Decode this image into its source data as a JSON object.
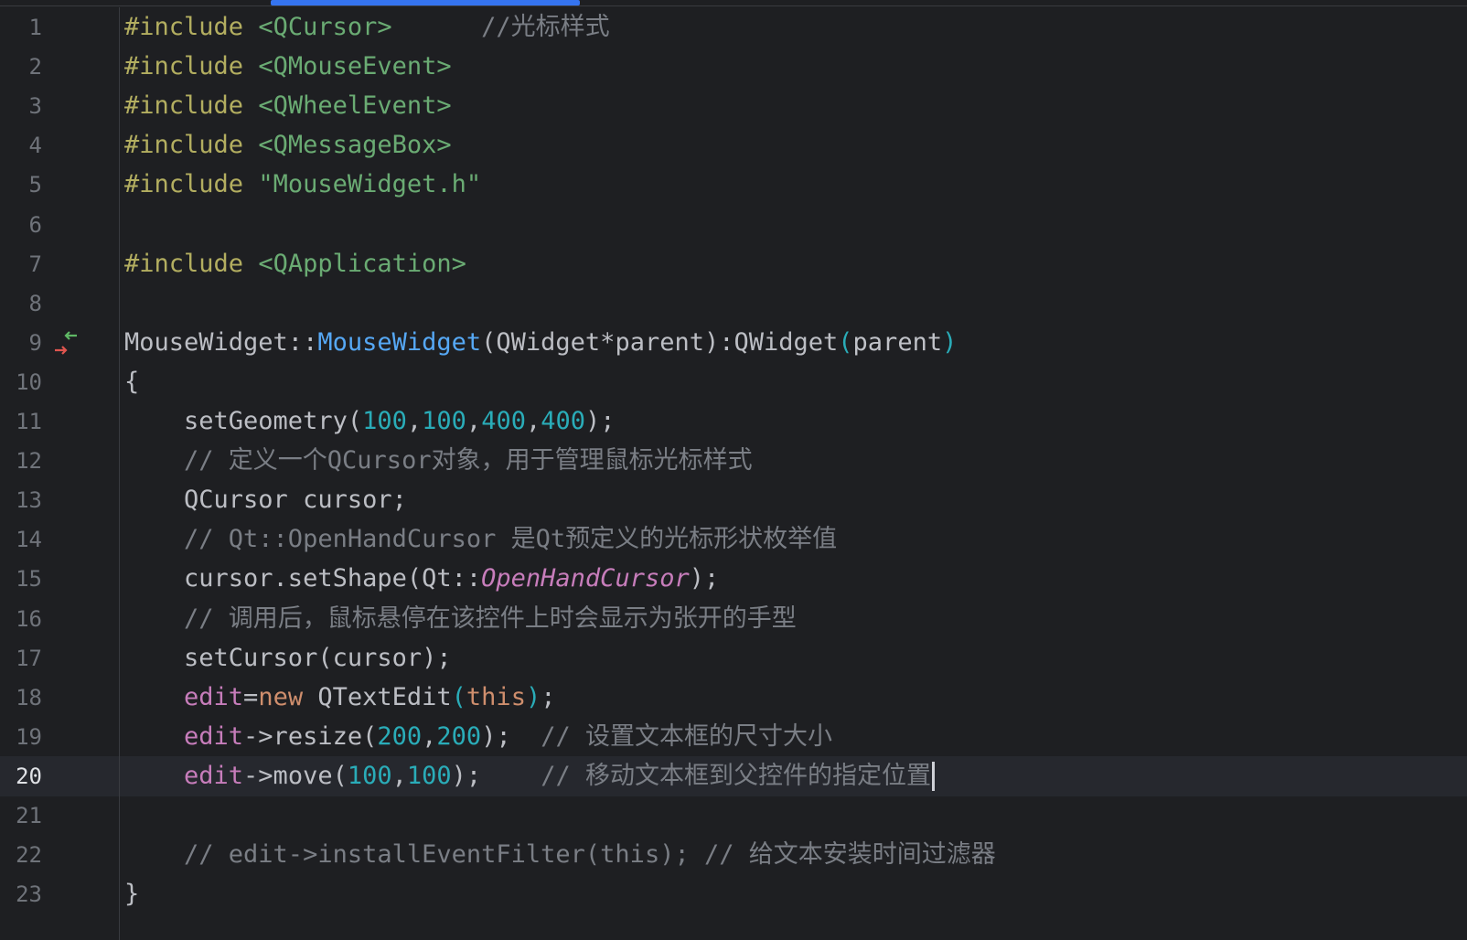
{
  "lines": [
    {
      "n": "1",
      "parts": [
        {
          "c": "kw-pp",
          "t": "#include "
        },
        {
          "c": "inc",
          "t": "<QCursor>"
        },
        {
          "c": "cmt",
          "t": "      //光标样式"
        }
      ]
    },
    {
      "n": "2",
      "parts": [
        {
          "c": "kw-pp",
          "t": "#include "
        },
        {
          "c": "inc",
          "t": "<QMouseEvent>"
        }
      ]
    },
    {
      "n": "3",
      "parts": [
        {
          "c": "kw-pp",
          "t": "#include "
        },
        {
          "c": "inc",
          "t": "<QWheelEvent>"
        }
      ]
    },
    {
      "n": "4",
      "parts": [
        {
          "c": "kw-pp",
          "t": "#include "
        },
        {
          "c": "inc",
          "t": "<QMessageBox>"
        }
      ]
    },
    {
      "n": "5",
      "parts": [
        {
          "c": "kw-pp",
          "t": "#include "
        },
        {
          "c": "inc",
          "t": "\"MouseWidget.h\""
        }
      ]
    },
    {
      "n": "6",
      "parts": []
    },
    {
      "n": "7",
      "parts": [
        {
          "c": "kw-pp",
          "t": "#include "
        },
        {
          "c": "inc",
          "t": "<QApplication>"
        }
      ]
    },
    {
      "n": "8",
      "parts": []
    },
    {
      "n": "9",
      "parts": [
        {
          "c": "cls",
          "t": "MouseWidget::"
        },
        {
          "c": "fnc",
          "t": "MouseWidget"
        },
        {
          "c": "cls",
          "t": "(QWidget*parent):QWidget"
        },
        {
          "c": "paren-hl",
          "t": "("
        },
        {
          "c": "par",
          "t": "parent"
        },
        {
          "c": "paren-hl",
          "t": ")"
        }
      ]
    },
    {
      "n": "10",
      "parts": [
        {
          "c": "cls",
          "t": "{"
        }
      ]
    },
    {
      "n": "11",
      "parts": [
        {
          "c": "cls",
          "t": "    setGeometry("
        },
        {
          "c": "num",
          "t": "100"
        },
        {
          "c": "cls",
          "t": ","
        },
        {
          "c": "num",
          "t": "100"
        },
        {
          "c": "cls",
          "t": ","
        },
        {
          "c": "num",
          "t": "400"
        },
        {
          "c": "cls",
          "t": ","
        },
        {
          "c": "num",
          "t": "400"
        },
        {
          "c": "cls",
          "t": ");"
        }
      ]
    },
    {
      "n": "12",
      "parts": [
        {
          "c": "cmt",
          "t": "    // 定义一个QCursor对象，用于管理鼠标光标样式"
        }
      ]
    },
    {
      "n": "13",
      "parts": [
        {
          "c": "cls",
          "t": "    QCursor cursor;"
        }
      ]
    },
    {
      "n": "14",
      "parts": [
        {
          "c": "cmt",
          "t": "    // Qt::OpenHandCursor 是Qt预定义的光标形状枚举值"
        }
      ]
    },
    {
      "n": "15",
      "parts": [
        {
          "c": "cls",
          "t": "    cursor.setShape(Qt::"
        },
        {
          "c": "enum",
          "t": "OpenHandCursor"
        },
        {
          "c": "cls",
          "t": ");"
        }
      ]
    },
    {
      "n": "16",
      "parts": [
        {
          "c": "cmt",
          "t": "    // 调用后，鼠标悬停在该控件上时会显示为张开的手型"
        }
      ]
    },
    {
      "n": "17",
      "parts": [
        {
          "c": "cls",
          "t": "    setCursor(cursor);"
        }
      ]
    },
    {
      "n": "18",
      "parts": [
        {
          "c": "fld",
          "t": "    edit"
        },
        {
          "c": "cls",
          "t": "="
        },
        {
          "c": "kw",
          "t": "new"
        },
        {
          "c": "cls",
          "t": " QTextEdit"
        },
        {
          "c": "paren-hl",
          "t": "("
        },
        {
          "c": "kw",
          "t": "this"
        },
        {
          "c": "paren-hl",
          "t": ")"
        },
        {
          "c": "cls",
          "t": ";"
        }
      ]
    },
    {
      "n": "19",
      "parts": [
        {
          "c": "fld",
          "t": "    edit"
        },
        {
          "c": "cls",
          "t": "->resize("
        },
        {
          "c": "num",
          "t": "200"
        },
        {
          "c": "cls",
          "t": ","
        },
        {
          "c": "num",
          "t": "200"
        },
        {
          "c": "cls",
          "t": ");  "
        },
        {
          "c": "cmt",
          "t": "// 设置文本框的尺寸大小"
        }
      ]
    },
    {
      "n": "20",
      "current": true,
      "parts": [
        {
          "c": "fld",
          "t": "    edit"
        },
        {
          "c": "cls",
          "t": "->move("
        },
        {
          "c": "num",
          "t": "100"
        },
        {
          "c": "cls",
          "t": ","
        },
        {
          "c": "num",
          "t": "100"
        },
        {
          "c": "cls",
          "t": ");    "
        },
        {
          "c": "cmt",
          "t": "// 移动文本框到父控件的指定位置"
        }
      ]
    },
    {
      "n": "21",
      "parts": []
    },
    {
      "n": "22",
      "parts": [
        {
          "c": "cmt",
          "t": "    // edit->installEventFilter(this); // 给文本安装时间过滤器"
        }
      ]
    },
    {
      "n": "23",
      "parts": [
        {
          "c": "cls",
          "t": "}"
        }
      ]
    }
  ],
  "gutter_icon_line": "9",
  "gutter_icon": "implementation-arrows-icon"
}
